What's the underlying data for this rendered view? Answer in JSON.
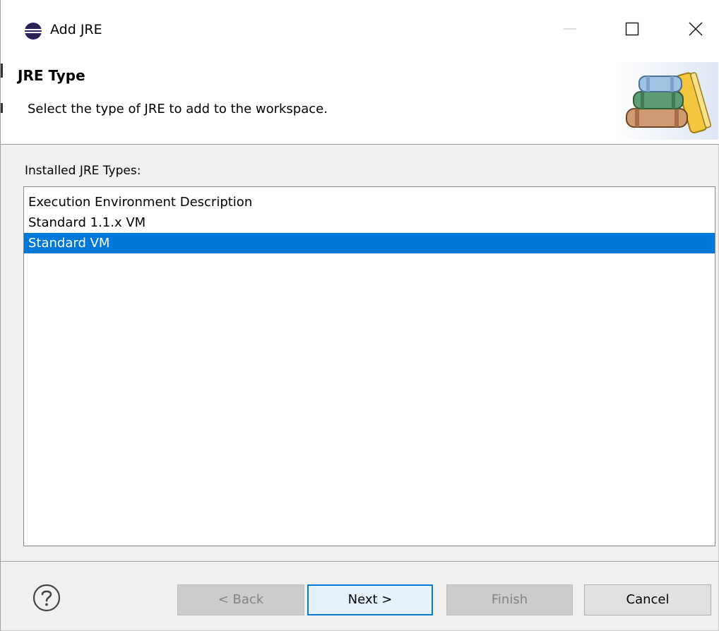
{
  "window": {
    "title": "Add JRE",
    "controls": [
      "minimize-icon",
      "maximize-icon",
      "close-icon"
    ]
  },
  "header": {
    "title": "JRE Type",
    "description": "Select the type of JRE to add to the workspace."
  },
  "list": {
    "label": "Installed JRE Types:",
    "items": [
      {
        "label": "Execution Environment Description",
        "selected": false
      },
      {
        "label": "Standard 1.1.x VM",
        "selected": false
      },
      {
        "label": "Standard VM",
        "selected": true
      }
    ]
  },
  "buttons": {
    "back": {
      "label": "< Back",
      "enabled": false
    },
    "next": {
      "label": "Next >",
      "enabled": true,
      "default": true
    },
    "finish": {
      "label": "Finish",
      "enabled": false
    },
    "cancel": {
      "label": "Cancel",
      "enabled": true
    }
  },
  "colors": {
    "selection": "#0078d7",
    "default_button_border": "#0078d7",
    "dialog_background": "#f0f0f0"
  }
}
